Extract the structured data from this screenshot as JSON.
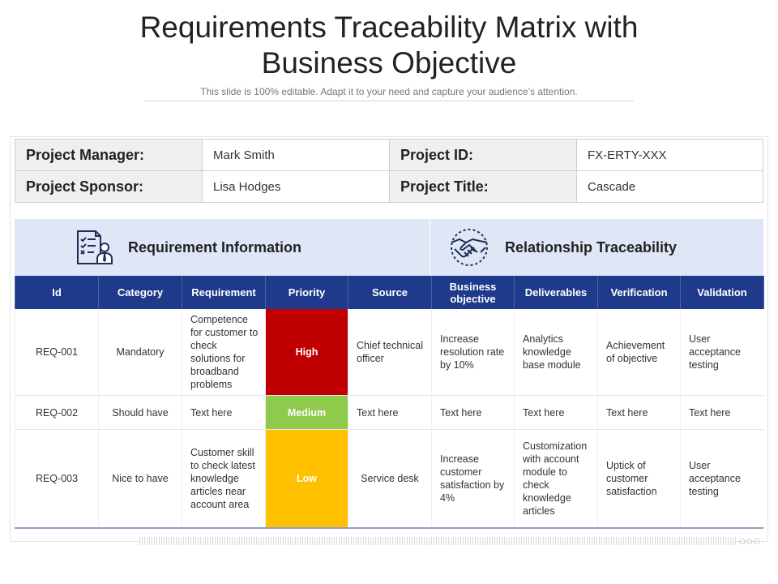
{
  "header": {
    "title_line1": "Requirements Traceability Matrix with",
    "title_line2": "Business Objective",
    "subtitle": "This slide is 100% editable. Adapt it to your need and capture your audience’s attention."
  },
  "project_info": {
    "manager_label": "Project Manager:",
    "manager_value": "Mark Smith",
    "id_label": "Project ID:",
    "id_value": "FX-ERTY-XXX",
    "sponsor_label": "Project Sponsor:",
    "sponsor_value": "Lisa Hodges",
    "title_label": "Project Title:",
    "title_value": "Cascade"
  },
  "sections": {
    "left": {
      "label": "Requirement Information",
      "icon": "checklist-person-icon"
    },
    "right": {
      "label": "Relationship Traceability",
      "icon": "handshake-icon"
    }
  },
  "columns": [
    "Id",
    "Category",
    "Requirement",
    "Priority",
    "Source",
    "Business objective",
    "Deliverables",
    "Verification",
    "Validation"
  ],
  "rows": [
    {
      "id": "REQ-001",
      "category": "Mandatory",
      "requirement": "Competence for customer to check solutions for broadband problems",
      "priority": "High",
      "source": "Chief technical officer",
      "objective": "Increase resolution rate by 10%",
      "deliverables": "Analytics knowledge base module",
      "verification": "Achievement of objective",
      "validation": "User acceptance testing"
    },
    {
      "id": "REQ-002",
      "category": "Should have",
      "requirement": "Text here",
      "priority": "Medium",
      "source": "Text here",
      "objective": "Text here",
      "deliverables": "Text here",
      "verification": "Text here",
      "validation": "Text here"
    },
    {
      "id": "REQ-003",
      "category": "Nice to have",
      "requirement": "Customer skill to check latest knowledge articles near account area",
      "priority": "Low",
      "source": "Service desk",
      "objective": "Increase customer satisfaction by 4%",
      "deliverables": "Customization with account module to check knowledge articles",
      "verification": "Uptick of customer satisfaction",
      "validation": "User acceptance testing"
    }
  ],
  "colors": {
    "header_blue": "#1f3a8a",
    "section_band": "#dfe7f7",
    "priority_high": "#c00000",
    "priority_medium": "#8fca4d",
    "priority_low": "#ffc000"
  }
}
